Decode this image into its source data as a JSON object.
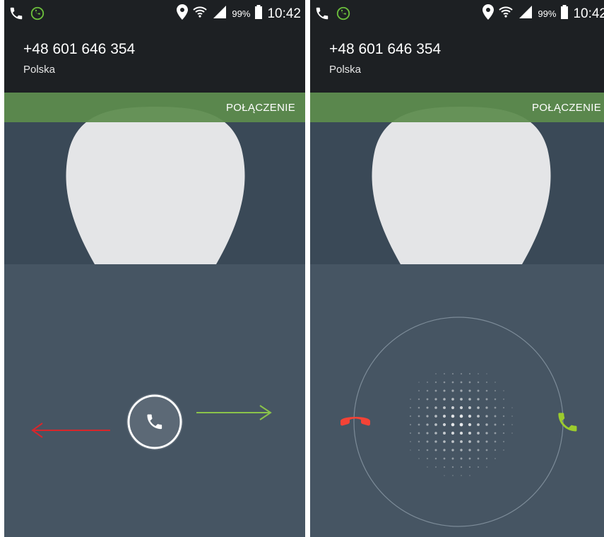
{
  "screens": [
    {
      "status_bar": {
        "battery_percent": "99%",
        "time": "10:42",
        "icons": [
          "phone-call-icon",
          "wifi-calling-icon",
          "location-pin-icon",
          "wifi-icon",
          "signal-icon",
          "battery-icon"
        ]
      },
      "caller": {
        "number": "+48 601 646 354",
        "location": "Polska"
      },
      "banner": {
        "label": "POŁĄCZENIE"
      },
      "controls": {
        "answer_button_icon": "phone-handset-icon",
        "decline_direction_icon": "arrow-left-icon",
        "accept_direction_icon": "arrow-right-icon",
        "colors": {
          "decline": "#e53935",
          "accept": "#8bc34a"
        }
      }
    },
    {
      "status_bar": {
        "battery_percent": "99%",
        "time": "10:42",
        "icons": [
          "phone-call-icon",
          "wifi-calling-icon",
          "location-pin-icon",
          "wifi-icon",
          "signal-icon",
          "battery-icon"
        ]
      },
      "caller": {
        "number": "+48 601 646 354",
        "location": "Polska"
      },
      "banner": {
        "label": "POŁĄCZENIE"
      },
      "controls": {
        "decline_icon": "phone-hangup-icon",
        "accept_icon": "phone-answer-icon",
        "colors": {
          "decline": "#f44336",
          "accept": "#9ccc2d"
        }
      }
    }
  ]
}
